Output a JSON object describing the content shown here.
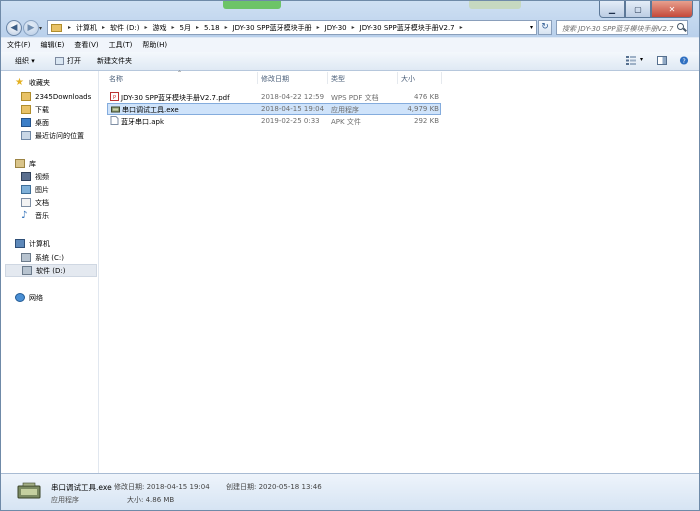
{
  "window": {
    "caption_buttons": {
      "minimize": "▁",
      "maximize": "▢",
      "close": "✕"
    }
  },
  "nav": {
    "back_glyph": "◀",
    "forward_glyph": "▶",
    "breadcrumbs": [
      "计算机",
      "软件 (D:)",
      "游戏",
      "5月",
      "5.18",
      "JDY-30 SPP蓝牙模块手册",
      "JDY-30",
      "JDY-30 SPP蓝牙模块手册V2.7"
    ],
    "refresh_glyph": "↻",
    "search_placeholder": "搜索 JDY-30 SPP蓝牙模块手册V2.7"
  },
  "menu": {
    "items": [
      "文件(F)",
      "编辑(E)",
      "查看(V)",
      "工具(T)",
      "帮助(H)"
    ]
  },
  "toolbar": {
    "organize": "组织 ▾",
    "open": "打开",
    "new_folder": "新建文件夹"
  },
  "sidebar": {
    "favorites_header": "收藏夹",
    "favorites": [
      "2345Downloads",
      "下载",
      "桌面",
      "最近访问的位置"
    ],
    "libraries_header": "库",
    "libraries": [
      "视频",
      "图片",
      "文档",
      "音乐"
    ],
    "computer_header": "计算机",
    "drives": [
      "系统 (C:)",
      "软件 (D:)"
    ],
    "network": "网络"
  },
  "columns": {
    "name": "名称",
    "date": "修改日期",
    "type": "类型",
    "size": "大小"
  },
  "files": [
    {
      "name": "JDY-30 SPP蓝牙模块手册V2.7.pdf",
      "date": "2018-04-22 12:59",
      "type": "WPS PDF 文档",
      "size": "476 KB",
      "icon": "pdf-file-icon"
    },
    {
      "name": "串口调试工具.exe",
      "date": "2018-04-15 19:04",
      "type": "应用程序",
      "size": "4,979 KB",
      "icon": "exe-file-icon"
    },
    {
      "name": "蓝牙串口.apk",
      "date": "2019-02-25 0:33",
      "type": "APK 文件",
      "size": "292 KB",
      "icon": "apk-file-icon"
    }
  ],
  "status": {
    "filename": "串口调试工具.exe",
    "modified": "修改日期: 2018-04-15 19:04",
    "created": "创建日期: 2020-05-18 13:46",
    "type": "应用程序",
    "size": "大小: 4.86 MB"
  },
  "colors": {
    "selection": "#cfe3fa",
    "selection_border": "#84acdd",
    "sidebar_selected": "#e4e9f0"
  }
}
